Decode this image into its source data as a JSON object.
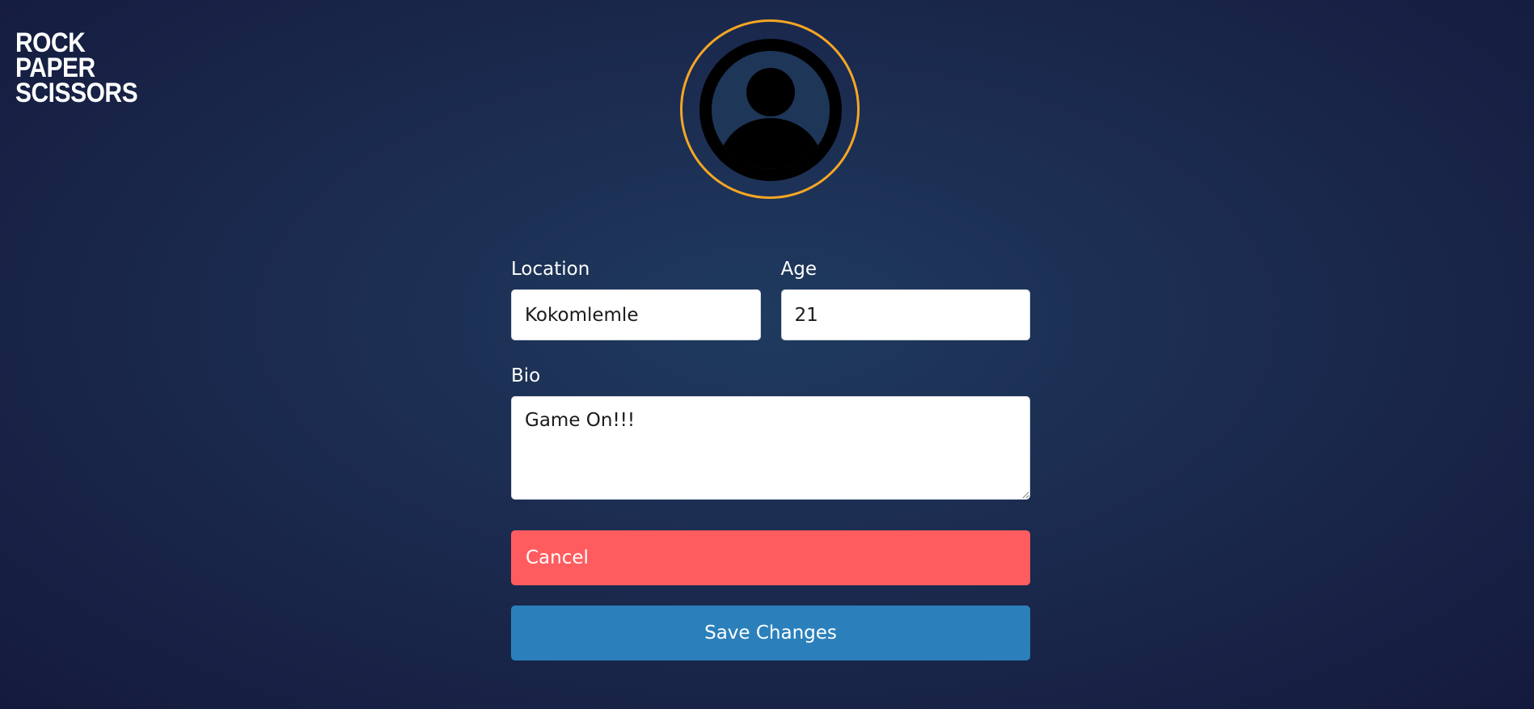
{
  "brand": {
    "logo_lines": [
      "ROCK",
      "PAPER",
      "SCISSORS"
    ]
  },
  "avatar": {
    "icon": "user-circle-icon",
    "ring_color": "#f5a623"
  },
  "form": {
    "location": {
      "label": "Location",
      "value": "Kokomlemle"
    },
    "age": {
      "label": "Age",
      "value": "21"
    },
    "bio": {
      "label": "Bio",
      "value": "Game On!!!"
    },
    "cancel_label": "Cancel",
    "save_label": "Save Changes"
  },
  "colors": {
    "cancel": "#ff5c5f",
    "save": "#2b80bb",
    "accent": "#f5a623"
  }
}
